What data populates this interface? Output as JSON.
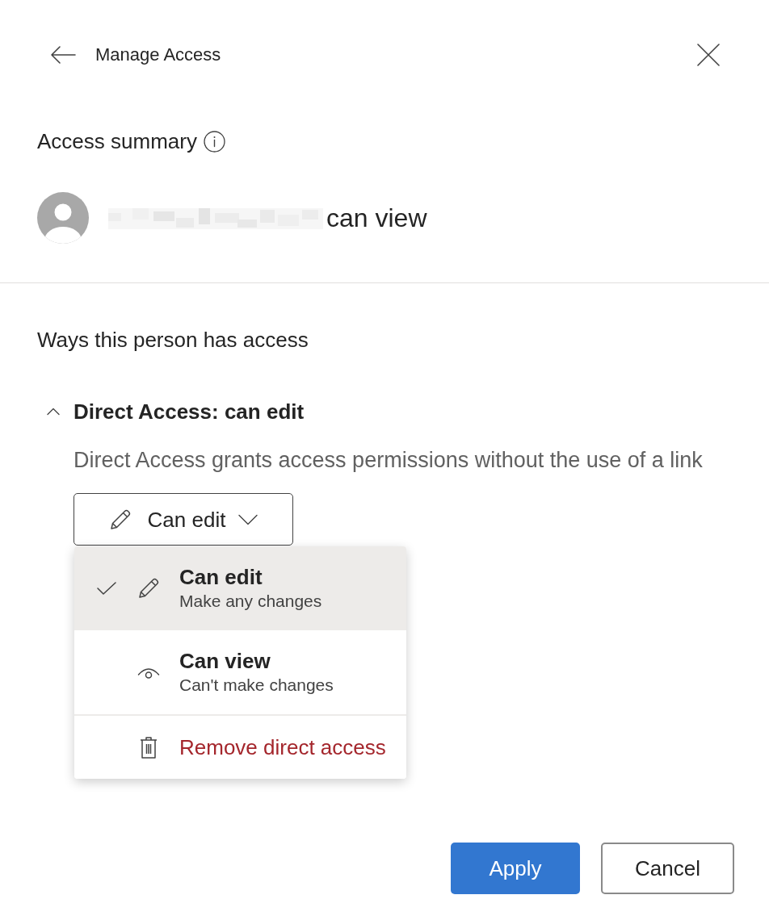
{
  "header": {
    "title": "Manage Access"
  },
  "summary": {
    "heading": "Access summary",
    "person": {
      "access": "can view"
    }
  },
  "ways": {
    "heading": "Ways this person has access",
    "groups": [
      {
        "title": "Direct Access: can edit",
        "expanded": true,
        "description": "Direct Access grants access permissions without the use of a link",
        "permission_button": {
          "label": "Can edit"
        },
        "menu": {
          "items": [
            {
              "kind": "edit",
              "title": "Can edit",
              "subtitle": "Make any changes",
              "selected": true
            },
            {
              "kind": "view",
              "title": "Can view",
              "subtitle": "Can't make changes",
              "selected": false
            },
            {
              "kind": "remove",
              "title": "Remove direct access",
              "selected": false
            }
          ]
        }
      }
    ]
  },
  "footer": {
    "buttons": [
      {
        "label": "Apply",
        "kind": "primary"
      },
      {
        "label": "Cancel",
        "kind": "secondary"
      }
    ]
  }
}
